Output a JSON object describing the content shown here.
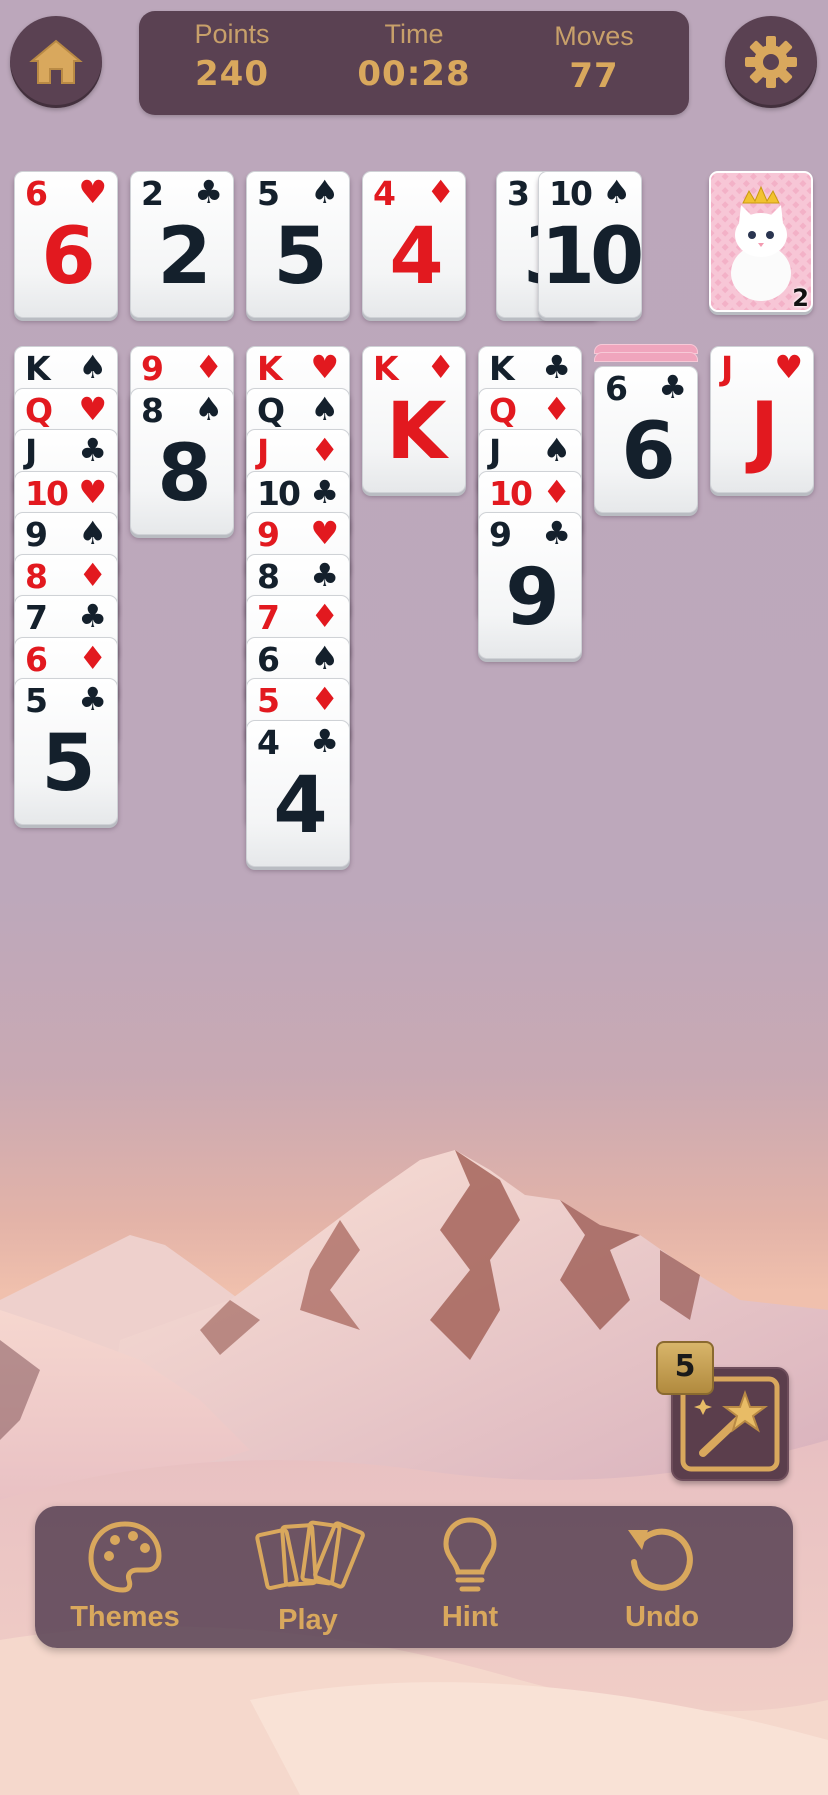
{
  "header": {
    "points_label": "Points",
    "points_value": "240",
    "time_label": "Time",
    "time_value": "00:28",
    "moves_label": "Moves",
    "moves_value": "77"
  },
  "icons": {
    "home": "home-icon",
    "settings": "gear-icon",
    "themes": "palette-icon",
    "play": "cards-icon",
    "hint": "lightbulb-icon",
    "undo": "undo-icon",
    "wand": "magic-wand-icon"
  },
  "colors": {
    "accent_gold": "#d9a85d",
    "panel": "#5a4152",
    "red_suit": "#e2191f",
    "black_suit": "#14202c"
  },
  "foundations": [
    {
      "rank": "6",
      "suit": "♥",
      "color": "red"
    },
    {
      "rank": "2",
      "suit": "♣",
      "color": "black"
    },
    {
      "rank": "5",
      "suit": "♠",
      "color": "black"
    },
    {
      "rank": "4",
      "suit": "♦",
      "color": "red"
    }
  ],
  "waste": [
    {
      "rank": "3",
      "suit": "",
      "color": "black"
    },
    {
      "rank": "10",
      "suit": "♠",
      "color": "black"
    }
  ],
  "stock": {
    "count": "2"
  },
  "tableau": [
    {
      "hidden": 0,
      "cards": [
        {
          "rank": "K",
          "suit": "♠",
          "color": "black"
        },
        {
          "rank": "Q",
          "suit": "♥",
          "color": "red"
        },
        {
          "rank": "J",
          "suit": "♣",
          "color": "black"
        },
        {
          "rank": "10",
          "suit": "♥",
          "color": "red"
        },
        {
          "rank": "9",
          "suit": "♠",
          "color": "black"
        },
        {
          "rank": "8",
          "suit": "♦",
          "color": "red"
        },
        {
          "rank": "7",
          "suit": "♣",
          "color": "black"
        },
        {
          "rank": "6",
          "suit": "♦",
          "color": "red"
        },
        {
          "rank": "5",
          "suit": "♣",
          "color": "black"
        }
      ]
    },
    {
      "hidden": 0,
      "cards": [
        {
          "rank": "9",
          "suit": "♦",
          "color": "red"
        },
        {
          "rank": "8",
          "suit": "♠",
          "color": "black"
        }
      ]
    },
    {
      "hidden": 0,
      "cards": [
        {
          "rank": "K",
          "suit": "♥",
          "color": "red"
        },
        {
          "rank": "Q",
          "suit": "♠",
          "color": "black"
        },
        {
          "rank": "J",
          "suit": "♦",
          "color": "red"
        },
        {
          "rank": "10",
          "suit": "♣",
          "color": "black"
        },
        {
          "rank": "9",
          "suit": "♥",
          "color": "red"
        },
        {
          "rank": "8",
          "suit": "♣",
          "color": "black"
        },
        {
          "rank": "7",
          "suit": "♦",
          "color": "red"
        },
        {
          "rank": "6",
          "suit": "♠",
          "color": "black"
        },
        {
          "rank": "5",
          "suit": "♦",
          "color": "red"
        },
        {
          "rank": "4",
          "suit": "♣",
          "color": "black"
        }
      ]
    },
    {
      "hidden": 0,
      "cards": [
        {
          "rank": "K",
          "suit": "♦",
          "color": "red"
        }
      ]
    },
    {
      "hidden": 0,
      "cards": [
        {
          "rank": "K",
          "suit": "♣",
          "color": "black"
        },
        {
          "rank": "Q",
          "suit": "♦",
          "color": "red"
        },
        {
          "rank": "J",
          "suit": "♠",
          "color": "black"
        },
        {
          "rank": "10",
          "suit": "♦",
          "color": "red"
        },
        {
          "rank": "9",
          "suit": "♣",
          "color": "black"
        }
      ]
    },
    {
      "hidden": 2,
      "cards": [
        {
          "rank": "6",
          "suit": "♣",
          "color": "black"
        }
      ]
    },
    {
      "hidden": 0,
      "cards": [
        {
          "rank": "J",
          "suit": "♥",
          "color": "red"
        }
      ]
    }
  ],
  "powerup": {
    "wand_count": "5"
  },
  "toolbar": {
    "themes_label": "Themes",
    "play_label": "Play",
    "hint_label": "Hint",
    "undo_label": "Undo"
  }
}
